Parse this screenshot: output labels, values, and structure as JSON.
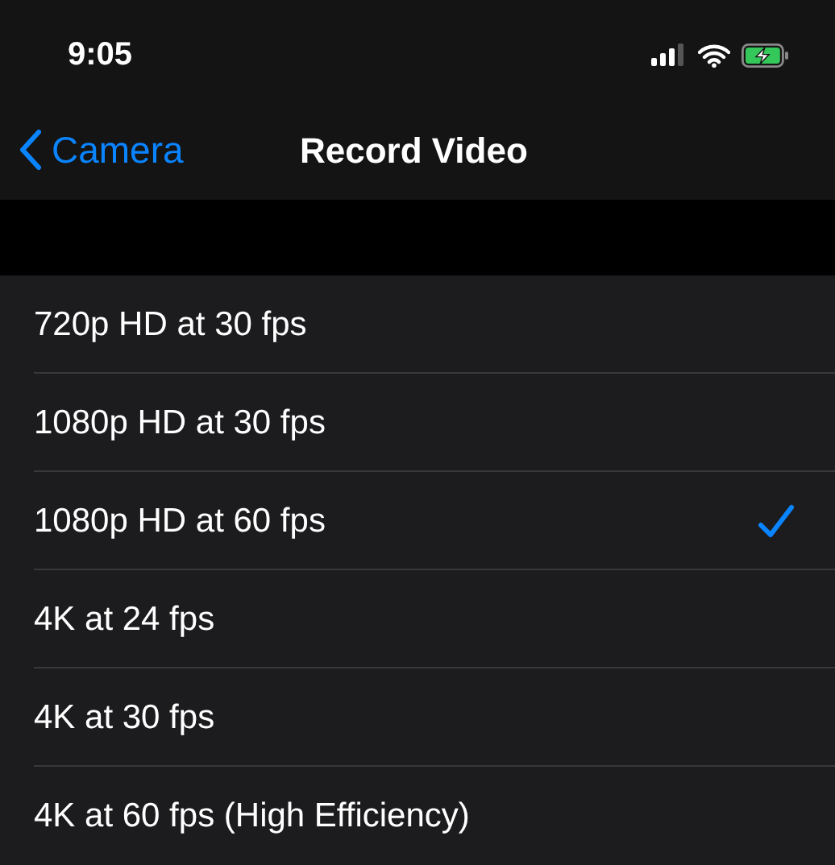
{
  "status_bar": {
    "time": "9:05"
  },
  "nav": {
    "back": "Camera",
    "title": "Record Video"
  },
  "options": [
    {
      "label": "720p HD at 30 fps",
      "selected": false
    },
    {
      "label": "1080p HD at 30 fps",
      "selected": false
    },
    {
      "label": "1080p HD at 60 fps",
      "selected": true
    },
    {
      "label": "4K at 24 fps",
      "selected": false
    },
    {
      "label": "4K at 30 fps",
      "selected": false
    },
    {
      "label": "4K at 60 fps (High Efficiency)",
      "selected": false
    }
  ]
}
